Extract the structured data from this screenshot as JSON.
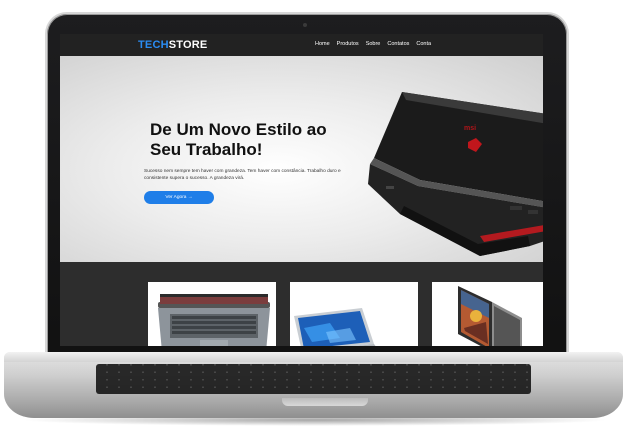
{
  "logo": {
    "part1": "TECH",
    "part2": "STORE"
  },
  "nav": {
    "items": [
      {
        "label": "Home"
      },
      {
        "label": "Produtos"
      },
      {
        "label": "Sobre"
      },
      {
        "label": "Contatos"
      },
      {
        "label": "Conta"
      }
    ]
  },
  "hero": {
    "title_line1": "De Um Novo Estilo ao",
    "title_line2": "Seu Trabalho!",
    "description": "Sucesso nem sempre tem haver com grandeza. Tem haver com constância. Trabalho duro e consistente supera o sucesso. A grandeza virá.",
    "cta_label": "Ver Agora →"
  },
  "products": [
    {
      "icon": "laptop-grey-icon"
    },
    {
      "icon": "laptop-windows-icon"
    },
    {
      "icon": "laptop-art-icon"
    }
  ],
  "colors": {
    "accent": "#1f7ee8",
    "logo_blue": "#2a8cf3",
    "nav_bg": "#222222",
    "products_bg": "#2d2d2d"
  }
}
